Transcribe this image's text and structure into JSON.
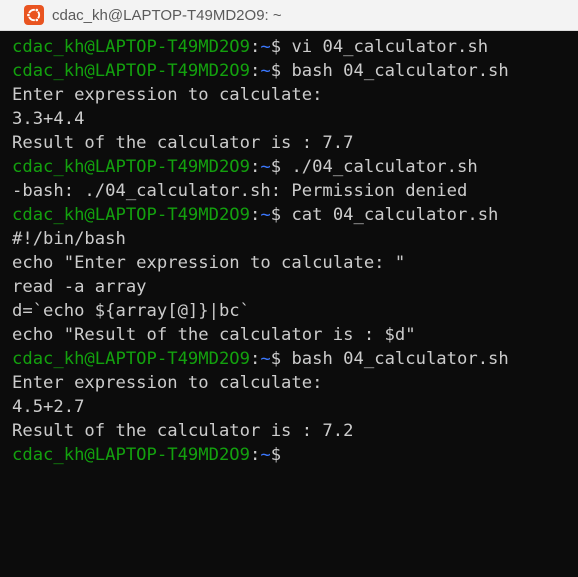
{
  "window": {
    "title": "cdac_kh@LAPTOP-T49MD2O9: ~",
    "icon": "ubuntu-icon"
  },
  "colors": {
    "background": "#0c0c0c",
    "text": "#cccccc",
    "prompt_user": "#13a10e",
    "prompt_path": "#3b78ff",
    "icon_bg": "#e95420"
  },
  "terminal": {
    "lines": [
      {
        "type": "prompt",
        "user": "cdac_kh@LAPTOP-T49MD2O9",
        "path": "~",
        "symbol": "$",
        "cmd": "vi 04_calculator.sh"
      },
      {
        "type": "prompt",
        "user": "cdac_kh@LAPTOP-T49MD2O9",
        "path": "~",
        "symbol": "$",
        "cmd": "bash 04_calculator.sh"
      },
      {
        "type": "output",
        "text": "Enter expression to calculate:"
      },
      {
        "type": "output",
        "text": "3.3+4.4"
      },
      {
        "type": "output",
        "text": "Result of the calculator is : 7.7"
      },
      {
        "type": "prompt",
        "user": "cdac_kh@LAPTOP-T49MD2O9",
        "path": "~",
        "symbol": "$",
        "cmd": "./04_calculator.sh"
      },
      {
        "type": "output",
        "text": "-bash: ./04_calculator.sh: Permission denied"
      },
      {
        "type": "prompt",
        "user": "cdac_kh@LAPTOP-T49MD2O9",
        "path": "~",
        "symbol": "$",
        "cmd": "cat 04_calculator.sh"
      },
      {
        "type": "output",
        "text": "#!/bin/bash"
      },
      {
        "type": "output",
        "text": "echo \"Enter expression to calculate: \""
      },
      {
        "type": "output",
        "text": "read -a array"
      },
      {
        "type": "output",
        "text": "d=`echo ${array[@]}|bc`"
      },
      {
        "type": "output",
        "text": "echo \"Result of the calculator is : $d\""
      },
      {
        "type": "prompt",
        "user": "cdac_kh@LAPTOP-T49MD2O9",
        "path": "~",
        "symbol": "$",
        "cmd": "bash 04_calculator.sh"
      },
      {
        "type": "output",
        "text": "Enter expression to calculate:"
      },
      {
        "type": "output",
        "text": "4.5+2.7"
      },
      {
        "type": "output",
        "text": "Result of the calculator is : 7.2"
      },
      {
        "type": "prompt",
        "user": "cdac_kh@LAPTOP-T49MD2O9",
        "path": "~",
        "symbol": "$",
        "cmd": ""
      }
    ]
  }
}
